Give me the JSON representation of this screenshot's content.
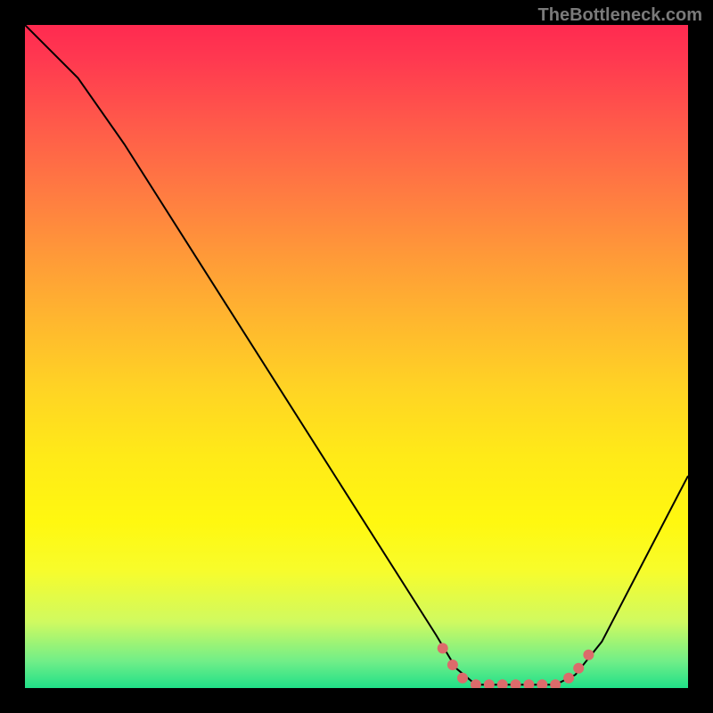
{
  "watermark": "TheBottleneck.com",
  "chart_data": {
    "type": "line",
    "title": "",
    "xlabel": "",
    "ylabel": "",
    "xlim": [
      0,
      100
    ],
    "ylim": [
      0,
      100
    ],
    "series": [
      {
        "name": "bottleneck-curve",
        "color": "#000000",
        "points": [
          {
            "x": 0,
            "y": 100
          },
          {
            "x": 8,
            "y": 92
          },
          {
            "x": 15,
            "y": 82
          },
          {
            "x": 62,
            "y": 8
          },
          {
            "x": 65,
            "y": 3
          },
          {
            "x": 68,
            "y": 0.5
          },
          {
            "x": 80,
            "y": 0.5
          },
          {
            "x": 83,
            "y": 2
          },
          {
            "x": 87,
            "y": 7
          },
          {
            "x": 100,
            "y": 32
          }
        ]
      },
      {
        "name": "highlight-markers",
        "color": "#dc6b6b",
        "points": [
          {
            "x": 63,
            "y": 6
          },
          {
            "x": 64.5,
            "y": 3.5
          },
          {
            "x": 66,
            "y": 1.5
          },
          {
            "x": 68,
            "y": 0.5
          },
          {
            "x": 70,
            "y": 0.5
          },
          {
            "x": 72,
            "y": 0.5
          },
          {
            "x": 74,
            "y": 0.5
          },
          {
            "x": 76,
            "y": 0.5
          },
          {
            "x": 78,
            "y": 0.5
          },
          {
            "x": 80,
            "y": 0.5
          },
          {
            "x": 82,
            "y": 1.5
          },
          {
            "x": 83.5,
            "y": 3
          },
          {
            "x": 85,
            "y": 5
          }
        ]
      }
    ],
    "gradient_stops": [
      {
        "pos": 0,
        "color": "#ff2a50"
      },
      {
        "pos": 50,
        "color": "#ffd424"
      },
      {
        "pos": 85,
        "color": "#f8fc2a"
      },
      {
        "pos": 100,
        "color": "#20e088"
      }
    ]
  }
}
